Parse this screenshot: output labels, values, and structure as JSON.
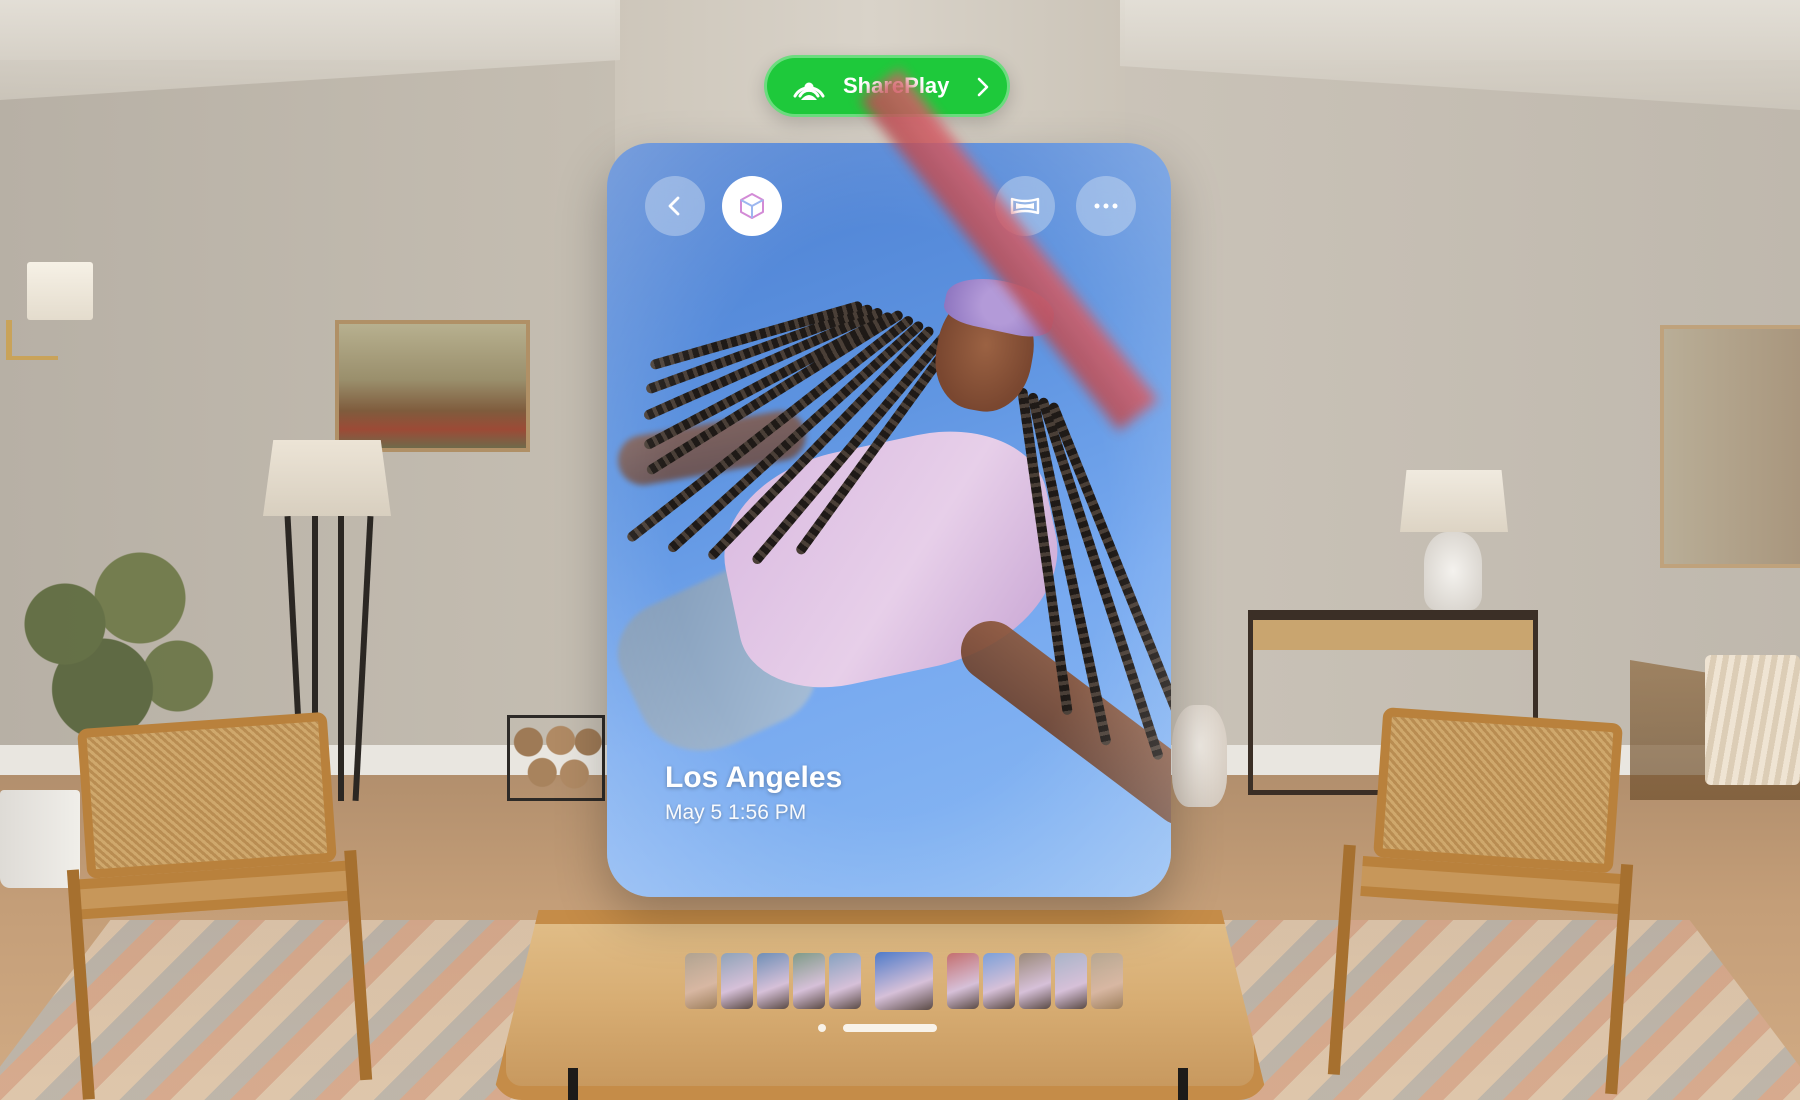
{
  "shareplay": {
    "label": "SharePlay",
    "icon": "shareplay-icon",
    "chevron": "chevron-right-icon",
    "color": "#1ec93b"
  },
  "photo": {
    "title": "Los Angeles",
    "subtitle": "May 5 1:56 PM"
  },
  "toolbar": {
    "back_icon": "chevron-left-icon",
    "spatial_icon": "cube-icon",
    "panorama_icon": "panorama-icon",
    "more_icon": "ellipsis-icon"
  },
  "thumbnails": {
    "count": 11,
    "selected_index": 5,
    "colors": [
      "#7e8fa8",
      "#8fa3b8",
      "#6f8fb6",
      "#7f9b88",
      "#86a2c0",
      "#4f7bc9",
      "#c46f6f",
      "#7ca0d8",
      "#9b8a7a",
      "#a8b4c8",
      "#8b98aa"
    ]
  },
  "pager": {
    "pages": 2,
    "active_page": 2
  }
}
